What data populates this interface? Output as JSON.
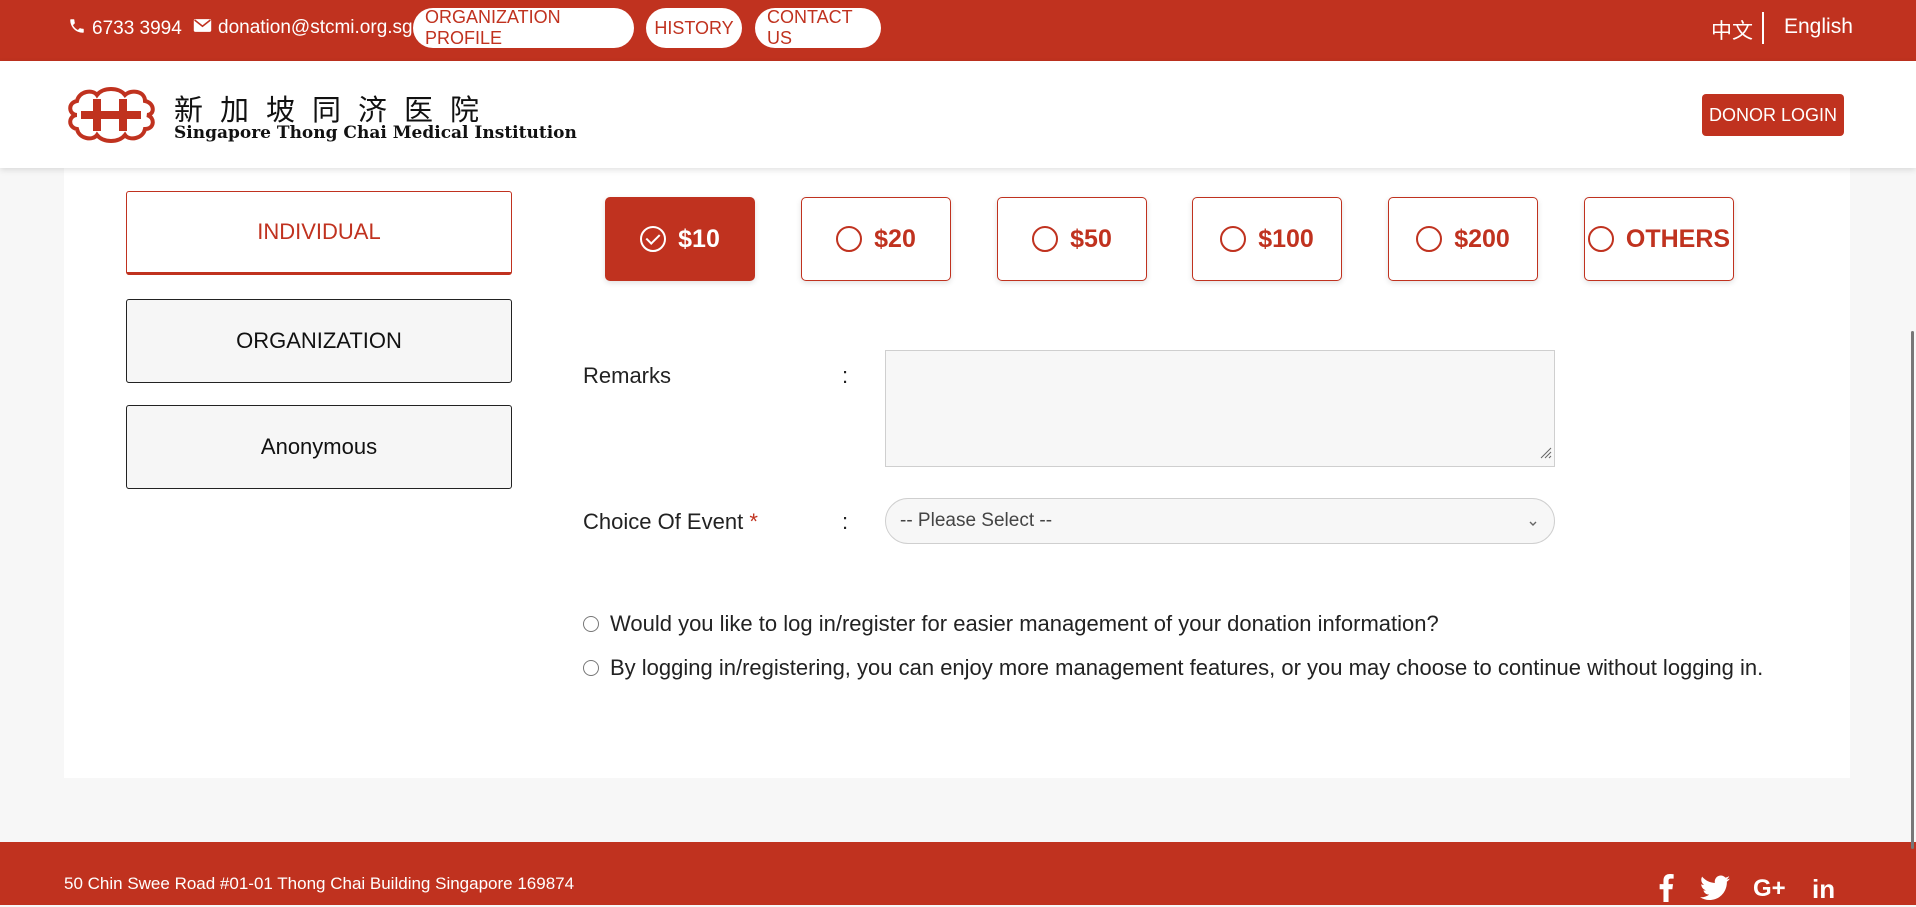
{
  "topbar": {
    "phone": "6733 3994",
    "email": "donation@stcmi.org.sg",
    "links": [
      "ORGANIZATION PROFILE",
      "HISTORY",
      "CONTACT US"
    ],
    "lang_zh": "中文",
    "lang_en": "English"
  },
  "header": {
    "logo_cn": "新加坡同济医院",
    "logo_en": "Singapore Thong Chai Medical Institution",
    "donor_login": "DONOR LOGIN"
  },
  "donor_types": [
    "INDIVIDUAL",
    "ORGANIZATION",
    "Anonymous"
  ],
  "amounts": [
    "$10",
    "$20",
    "$50",
    "$100",
    "$200",
    "OTHERS"
  ],
  "form": {
    "remarks_label": "Remarks",
    "event_label": "Choice Of Event",
    "required_mark": "*",
    "colon": ":",
    "event_placeholder": "-- Please Select --"
  },
  "options": [
    "Would you like to log in/register for easier management of your donation information?",
    "By logging in/registering, you can enjoy more management features, or you may choose to continue without logging in."
  ],
  "footer": {
    "address": "50 Chin Swee Road #01-01 Thong Chai Building Singapore 169874"
  },
  "colors": {
    "brand": "#c0321f"
  },
  "icons": [
    "phone-icon",
    "envelope-icon",
    "check-circle-icon",
    "facebook-icon",
    "twitter-icon",
    "google-plus-icon",
    "linkedin-icon"
  ]
}
